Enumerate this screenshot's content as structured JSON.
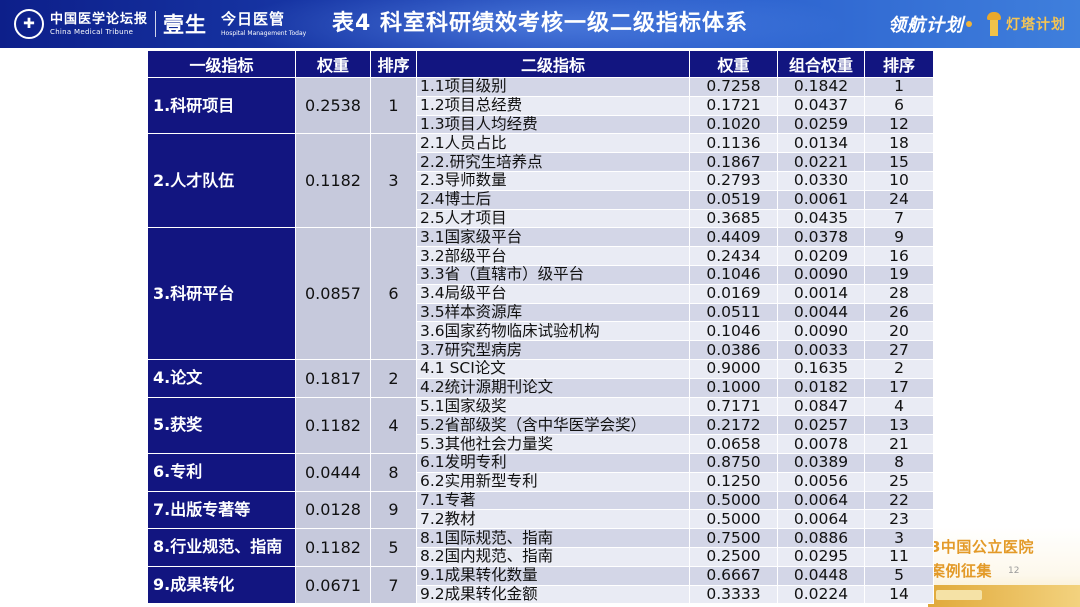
{
  "header": {
    "logo_cmt_cn": "中国医学论坛报",
    "logo_cmt_en": "China Medical Tribune",
    "logo_yisheng": "壹生",
    "logo_hmt_cn": "今日医管",
    "logo_hmt_en": "Hospital Management Today",
    "title": "表4  科室科研绩效考核一级二级指标体系",
    "logo_linghang": "领航计划",
    "logo_dengta": "灯塔计划"
  },
  "decoration": {
    "line1": "3中国公立医院",
    "line2": "案例征集",
    "slide_number": "12"
  },
  "table": {
    "headers": [
      "一级指标",
      "权重",
      "排序",
      "二级指标",
      "权重",
      "组合权重",
      "排序"
    ],
    "groups": [
      {
        "name": "1.科研项目",
        "weight": "0.2538",
        "rank": "1",
        "items": [
          {
            "name": "1.1项目级别",
            "weight": "0.7258",
            "combined": "0.1842",
            "rank": "1"
          },
          {
            "name": "1.2项目总经费",
            "weight": "0.1721",
            "combined": "0.0437",
            "rank": "6"
          },
          {
            "name": "1.3项目人均经费",
            "weight": "0.1020",
            "combined": "0.0259",
            "rank": "12"
          }
        ]
      },
      {
        "name": "2.人才队伍",
        "weight": "0.1182",
        "rank": "3",
        "items": [
          {
            "name": "2.1人员占比",
            "weight": "0.1136",
            "combined": "0.0134",
            "rank": "18"
          },
          {
            "name": "2.2.研究生培养点",
            "weight": "0.1867",
            "combined": "0.0221",
            "rank": "15"
          },
          {
            "name": "2.3导师数量",
            "weight": "0.2793",
            "combined": "0.0330",
            "rank": "10"
          },
          {
            "name": "2.4博士后",
            "weight": "0.0519",
            "combined": "0.0061",
            "rank": "24"
          },
          {
            "name": "2.5人才项目",
            "weight": "0.3685",
            "combined": "0.0435",
            "rank": "7"
          }
        ]
      },
      {
        "name": "3.科研平台",
        "weight": "0.0857",
        "rank": "6",
        "items": [
          {
            "name": "3.1国家级平台",
            "weight": "0.4409",
            "combined": "0.0378",
            "rank": "9"
          },
          {
            "name": "3.2部级平台",
            "weight": "0.2434",
            "combined": "0.0209",
            "rank": "16"
          },
          {
            "name": "3.3省（直辖市）级平台",
            "weight": "0.1046",
            "combined": "0.0090",
            "rank": "19"
          },
          {
            "name": "3.4局级平台",
            "weight": "0.0169",
            "combined": "0.0014",
            "rank": "28"
          },
          {
            "name": "3.5样本资源库",
            "weight": "0.0511",
            "combined": "0.0044",
            "rank": "26"
          },
          {
            "name": "3.6国家药物临床试验机构",
            "weight": "0.1046",
            "combined": "0.0090",
            "rank": "20"
          },
          {
            "name": "3.7研究型病房",
            "weight": "0.0386",
            "combined": "0.0033",
            "rank": "27"
          }
        ]
      },
      {
        "name": "4.论文",
        "weight": "0.1817",
        "rank": "2",
        "items": [
          {
            "name": "4.1 SCI论文",
            "weight": "0.9000",
            "combined": "0.1635",
            "rank": "2"
          },
          {
            "name": "4.2统计源期刊论文",
            "weight": "0.1000",
            "combined": "0.0182",
            "rank": "17"
          }
        ]
      },
      {
        "name": "5.获奖",
        "weight": "0.1182",
        "rank": "4",
        "items": [
          {
            "name": "5.1国家级奖",
            "weight": "0.7171",
            "combined": "0.0847",
            "rank": "4"
          },
          {
            "name": "5.2省部级奖（含中华医学会奖）",
            "weight": "0.2172",
            "combined": "0.0257",
            "rank": "13"
          },
          {
            "name": "5.3其他社会力量奖",
            "weight": "0.0658",
            "combined": "0.0078",
            "rank": "21"
          }
        ]
      },
      {
        "name": "6.专利",
        "weight": "0.0444",
        "rank": "8",
        "items": [
          {
            "name": "6.1发明专利",
            "weight": "0.8750",
            "combined": "0.0389",
            "rank": "8"
          },
          {
            "name": "6.2实用新型专利",
            "weight": "0.1250",
            "combined": "0.0056",
            "rank": "25"
          }
        ]
      },
      {
        "name": "7.出版专著等",
        "weight": "0.0128",
        "rank": "9",
        "items": [
          {
            "name": "7.1专著",
            "weight": "0.5000",
            "combined": "0.0064",
            "rank": "22"
          },
          {
            "name": "7.2教材",
            "weight": "0.5000",
            "combined": "0.0064",
            "rank": "23"
          }
        ]
      },
      {
        "name": "8.行业规范、指南",
        "weight": "0.1182",
        "rank": "5",
        "items": [
          {
            "name": "8.1国际规范、指南",
            "weight": "0.7500",
            "combined": "0.0886",
            "rank": "3"
          },
          {
            "name": "8.2国内规范、指南",
            "weight": "0.2500",
            "combined": "0.0295",
            "rank": "11"
          }
        ]
      },
      {
        "name": "9.成果转化",
        "weight": "0.0671",
        "rank": "7",
        "items": [
          {
            "name": "9.1成果转化数量",
            "weight": "0.6667",
            "combined": "0.0448",
            "rank": "5"
          },
          {
            "name": "9.2成果转化金额",
            "weight": "0.3333",
            "combined": "0.0224",
            "rank": "14"
          }
        ]
      }
    ]
  }
}
